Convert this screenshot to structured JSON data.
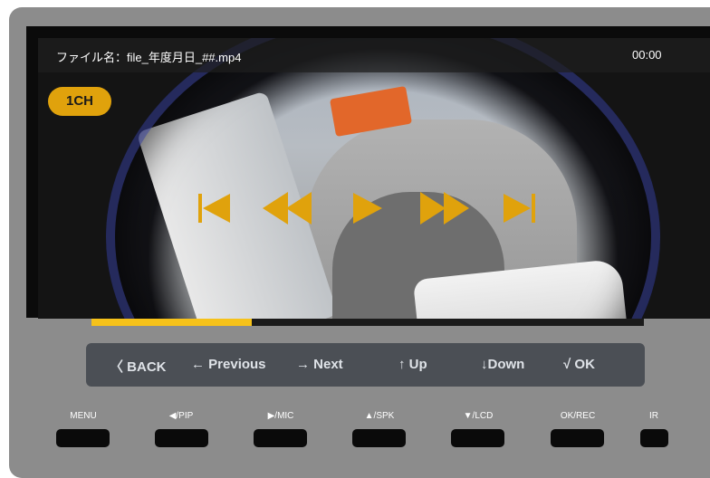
{
  "header": {
    "filename": "ファイル名：file_年度月日_##.mp4",
    "time": "00:00"
  },
  "channel_badge": "1CH",
  "playback": {
    "progress_fraction": 0.29,
    "accent_color": "#e0a20c",
    "controls": [
      "skip-back-icon",
      "rewind-icon",
      "play-icon",
      "fast-forward-icon",
      "skip-forward-icon"
    ]
  },
  "menu": {
    "back": "〈 BACK",
    "previous": "← Previous",
    "next": "→  Next",
    "up": "↑  Up",
    "down": "↓Down",
    "ok": "√ OK"
  },
  "buttons": {
    "menu": "MENU",
    "pip": "◀/PIP",
    "mic": "▶/MIC",
    "spk": "▲/SPK",
    "lcd": "▼/LCD",
    "okrec": "OK/REC",
    "ir": "IR"
  }
}
